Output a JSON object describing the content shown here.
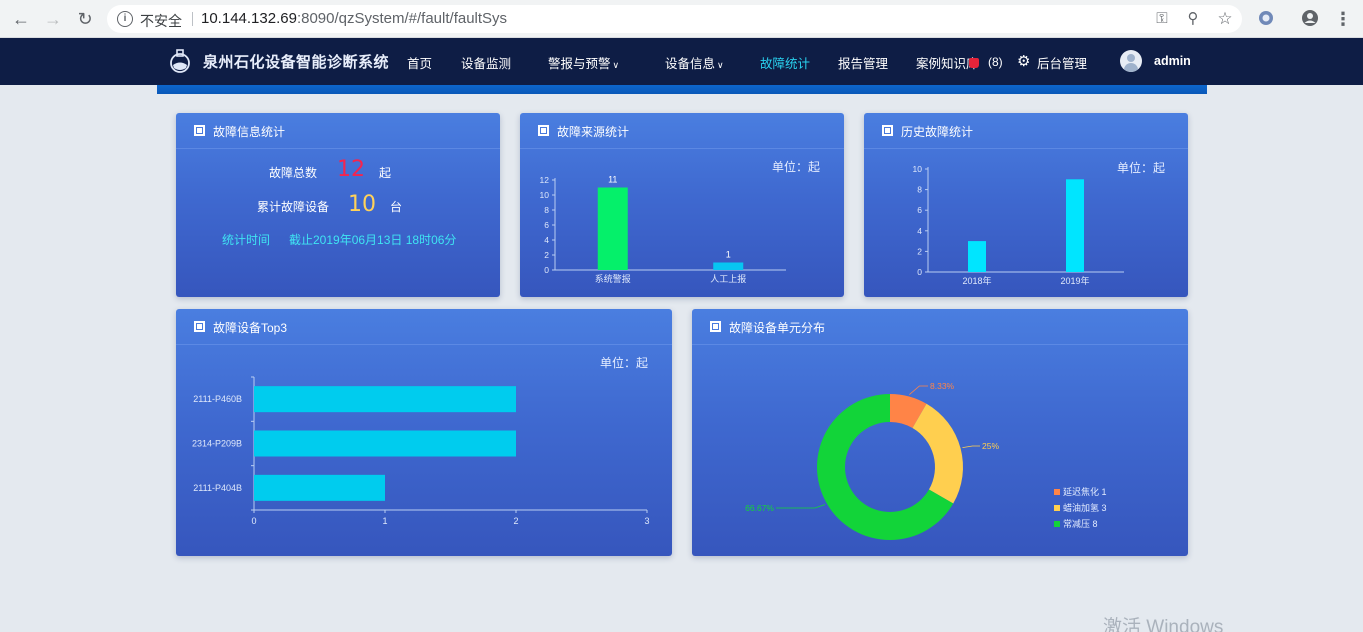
{
  "browser": {
    "insecure_label": "不安全",
    "url_host": "10.144.132.69",
    "url_rest": ":8090/qzSystem/#/fault/faultSys"
  },
  "header": {
    "app_title": "泉州石化设备智能诊断系统",
    "nav": [
      {
        "label": "首页",
        "dropdown": false,
        "active": false
      },
      {
        "label": "设备监测",
        "dropdown": false,
        "active": false
      },
      {
        "label": "警报与预警",
        "dropdown": true,
        "active": false
      },
      {
        "label": "设备信息",
        "dropdown": true,
        "active": false
      },
      {
        "label": "故障统计",
        "dropdown": false,
        "active": true
      },
      {
        "label": "报告管理",
        "dropdown": false,
        "active": false
      },
      {
        "label": "案例知识库",
        "dropdown": false,
        "active": false
      }
    ],
    "notification_count": "(8)",
    "admin_label": "后台管理",
    "username": "admin"
  },
  "cards": {
    "fault_info": {
      "title": "故障信息统计",
      "total_label": "故障总数",
      "total_value": "12",
      "total_unit": "起",
      "equip_label": "累计故障设备",
      "equip_value": "10",
      "equip_unit": "台",
      "time_label": "统计时间",
      "time_value": "截止2019年06月13日 18时06分"
    },
    "fault_source": {
      "title": "故障来源统计",
      "unit": "单位：起"
    },
    "fault_history": {
      "title": "历史故障统计",
      "unit": "单位：起"
    },
    "top3": {
      "title": "故障设备Top3",
      "unit": "单位：起"
    },
    "unit_dist": {
      "title": "故障设备单元分布"
    }
  },
  "chart_data": [
    {
      "type": "bar",
      "categories": [
        "系统警报",
        "人工上报"
      ],
      "values": [
        11,
        1
      ],
      "colors": [
        "#05f06a",
        "#07c6f2"
      ],
      "ylim": [
        0,
        12
      ],
      "yticks": [
        0,
        2,
        4,
        6,
        8,
        10,
        12
      ],
      "data_labels": true
    },
    {
      "type": "bar",
      "categories": [
        "2018年",
        "2019年"
      ],
      "values": [
        3,
        9
      ],
      "colors": [
        "#00e5ff",
        "#00e5ff"
      ],
      "ylim": [
        0,
        10
      ],
      "yticks": [
        0,
        2,
        4,
        6,
        8,
        10
      ]
    },
    {
      "type": "bar",
      "orientation": "horizontal",
      "categories": [
        "2111-P404B",
        "2314-P209B",
        "2111-P460B"
      ],
      "values": [
        1,
        2,
        2
      ],
      "color": "#00ccee",
      "xlim": [
        0,
        3
      ],
      "xticks": [
        0,
        1,
        2,
        3
      ]
    },
    {
      "type": "pie",
      "donut": true,
      "slices": [
        {
          "name": "延迟焦化",
          "value": 1,
          "label": "8.33%",
          "color": "#ff8447"
        },
        {
          "name": "蜡油加氢",
          "value": 3,
          "label": "25%",
          "color": "#ffcf4f"
        },
        {
          "name": "常减压",
          "value": 8,
          "label": "66.67%",
          "color": "#12d439"
        }
      ],
      "legend_position": "bottom-right"
    }
  ],
  "watermark": "激活 Windows"
}
